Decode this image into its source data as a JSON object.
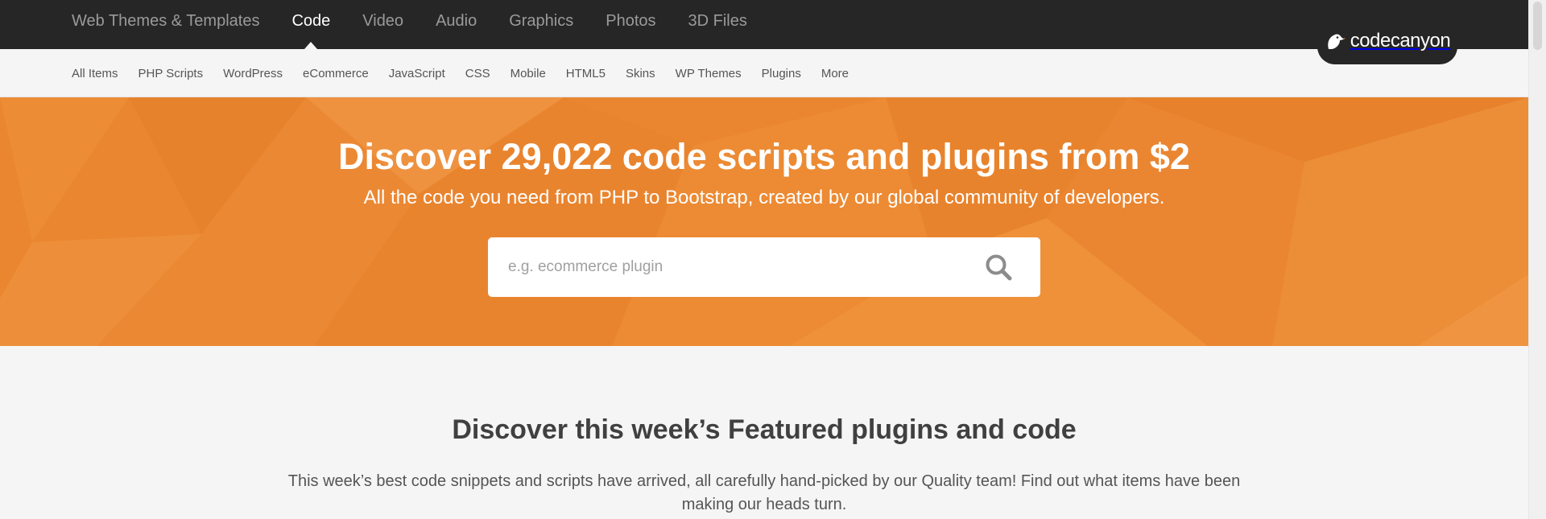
{
  "top_nav": {
    "items": [
      {
        "label": "Web Themes & Templates"
      },
      {
        "label": "Code",
        "active": true
      },
      {
        "label": "Video"
      },
      {
        "label": "Audio"
      },
      {
        "label": "Graphics"
      },
      {
        "label": "Photos"
      },
      {
        "label": "3D Files"
      }
    ]
  },
  "brand": {
    "name": "codecanyon",
    "icon": "leaf-logo-icon"
  },
  "sub_nav": {
    "items": [
      {
        "label": "All Items"
      },
      {
        "label": "PHP Scripts"
      },
      {
        "label": "WordPress"
      },
      {
        "label": "eCommerce"
      },
      {
        "label": "JavaScript"
      },
      {
        "label": "CSS"
      },
      {
        "label": "Mobile"
      },
      {
        "label": "HTML5"
      },
      {
        "label": "Skins"
      },
      {
        "label": "WP Themes"
      },
      {
        "label": "Plugins"
      },
      {
        "label": "More"
      }
    ]
  },
  "hero": {
    "title": "Discover 29,022 code scripts and plugins from $2",
    "subtitle": "All the code you need from PHP to Bootstrap, created by our global community of developers.",
    "search": {
      "placeholder": "e.g. ecommerce plugin",
      "value": "",
      "icon": "search-icon"
    }
  },
  "featured": {
    "title": "Discover this week’s Featured plugins and code",
    "description": "This week’s best code snippets and scripts have arrived, all carefully hand-picked by our Quality team! Find out what items have been making our heads turn."
  },
  "colors": {
    "top_bar": "#262626",
    "hero_orange": "#ea8630",
    "page_bg": "#f5f5f5",
    "heading": "#404040"
  }
}
